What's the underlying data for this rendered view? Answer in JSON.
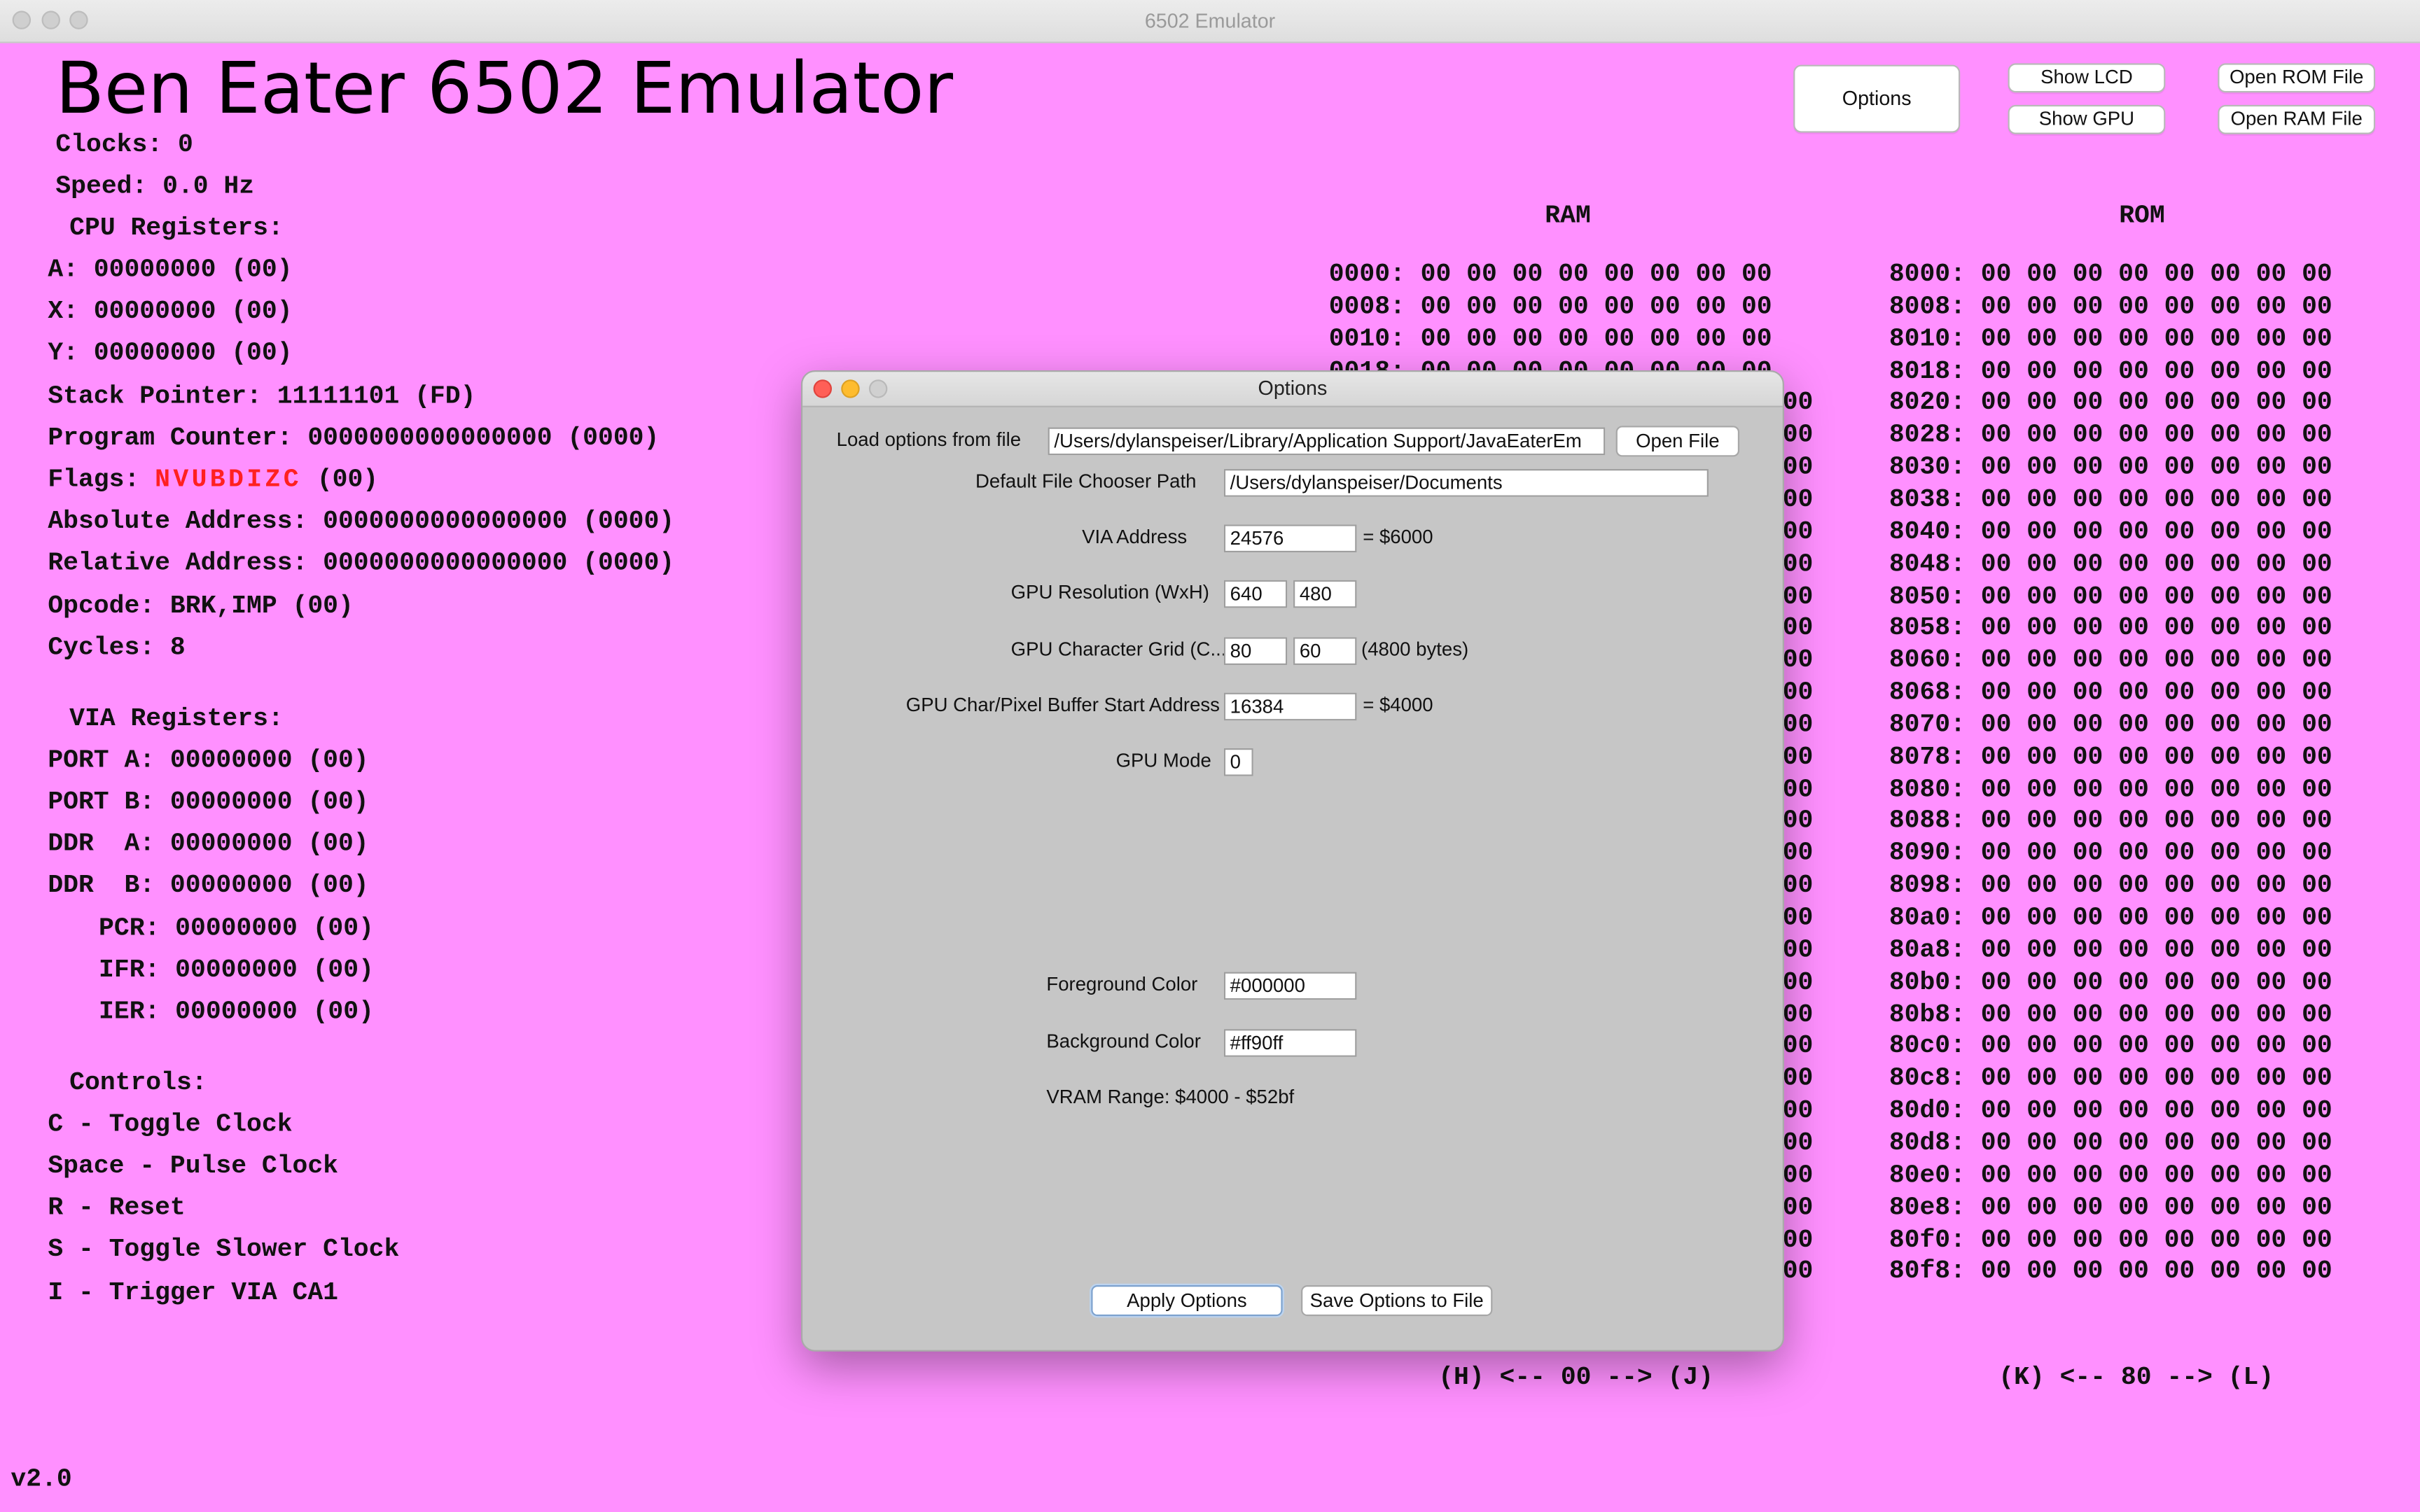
{
  "window": {
    "title": "6502 Emulator"
  },
  "app_title": "Ben Eater 6502 Emulator",
  "status": {
    "clocks": "Clocks: 0",
    "speed": "Speed: 0.0 Hz"
  },
  "cpu": {
    "header": "CPU Registers:",
    "a": "A: 00000000 (00)",
    "x": "X: 00000000 (00)",
    "y": "Y: 00000000 (00)",
    "sp": "Stack Pointer: 11111101 (FD)",
    "pc": "Program Counter: 0000000000000000 (0000)",
    "flags_label": "Flags: ",
    "flags_value": "NVUBDIZC",
    "flags_hex": " (00)",
    "abs": "Absolute Address: 0000000000000000 (0000)",
    "rel": "Relative Address: 0000000000000000 (0000)",
    "opcode": "Opcode: BRK,IMP (00)",
    "cycles": "Cycles: 8"
  },
  "via": {
    "header": "VIA Registers:",
    "porta": "PORT A: 00000000 (00)",
    "portb": "PORT B: 00000000 (00)",
    "ddra": "DDR  A: 00000000 (00)",
    "ddrb": "DDR  B: 00000000 (00)",
    "pcr": "PCR: 00000000 (00)",
    "ifr": "IFR: 00000000 (00)",
    "ier": "IER: 00000000 (00)"
  },
  "controls": {
    "header": "Controls:",
    "items": [
      "C - Toggle Clock",
      "Space - Pulse Clock",
      "R - Reset",
      "S - Toggle Slower Clock",
      "I - Trigger VIA CA1"
    ]
  },
  "version": "v2.0",
  "buttons": {
    "options": "Options",
    "show_lcd": "Show LCD",
    "show_gpu": "Show GPU",
    "open_rom": "Open ROM File",
    "open_ram": "Open RAM File"
  },
  "ram": {
    "title": "RAM",
    "rows": [
      "0000: 00 00 00 00 00 00 00 00",
      "0008: 00 00 00 00 00 00 00 00",
      "0010: 00 00 00 00 00 00 00 00",
      "0018: 00 00 00 00 00 00 00 00"
    ],
    "visible_tail": "00",
    "nav": "(H) <-- 00 --> (J)"
  },
  "rom": {
    "title": "ROM",
    "rows": [
      "8000: 00 00 00 00 00 00 00 00",
      "8008: 00 00 00 00 00 00 00 00",
      "8010: 00 00 00 00 00 00 00 00",
      "8018: 00 00 00 00 00 00 00 00",
      "8020: 00 00 00 00 00 00 00 00",
      "8028: 00 00 00 00 00 00 00 00",
      "8030: 00 00 00 00 00 00 00 00",
      "8038: 00 00 00 00 00 00 00 00",
      "8040: 00 00 00 00 00 00 00 00",
      "8048: 00 00 00 00 00 00 00 00",
      "8050: 00 00 00 00 00 00 00 00",
      "8058: 00 00 00 00 00 00 00 00",
      "8060: 00 00 00 00 00 00 00 00",
      "8068: 00 00 00 00 00 00 00 00",
      "8070: 00 00 00 00 00 00 00 00",
      "8078: 00 00 00 00 00 00 00 00",
      "8080: 00 00 00 00 00 00 00 00",
      "8088: 00 00 00 00 00 00 00 00",
      "8090: 00 00 00 00 00 00 00 00",
      "8098: 00 00 00 00 00 00 00 00",
      "80a0: 00 00 00 00 00 00 00 00",
      "80a8: 00 00 00 00 00 00 00 00",
      "80b0: 00 00 00 00 00 00 00 00",
      "80b8: 00 00 00 00 00 00 00 00",
      "80c0: 00 00 00 00 00 00 00 00",
      "80c8: 00 00 00 00 00 00 00 00",
      "80d0: 00 00 00 00 00 00 00 00",
      "80d8: 00 00 00 00 00 00 00 00",
      "80e0: 00 00 00 00 00 00 00 00",
      "80e8: 00 00 00 00 00 00 00 00",
      "80f0: 00 00 00 00 00 00 00 00",
      "80f8: 00 00 00 00 00 00 00 00"
    ],
    "nav": "(K) <-- 80 --> (L)"
  },
  "dialog": {
    "title": "Options",
    "load_label": "Load options from file",
    "load_value": "/Users/dylanspeiser/Library/Application Support/JavaEaterEm",
    "open_file": "Open File",
    "path_label": "Default File Chooser Path",
    "path_value": "/Users/dylanspeiser/Documents",
    "via_label": "VIA Address",
    "via_value": "24576",
    "via_hex": "= $6000",
    "gpu_res_label": "GPU Resolution (WxH)",
    "gpu_res_w": "640",
    "gpu_res_h": "480",
    "gpu_grid_label": "GPU Character Grid (C...",
    "gpu_grid_w": "80",
    "gpu_grid_h": "60",
    "gpu_grid_bytes": "(4800 bytes)",
    "gpu_buf_label": "GPU Char/Pixel Buffer Start Address",
    "gpu_buf_value": "16384",
    "gpu_buf_hex": "= $4000",
    "gpu_mode_label": "GPU Mode",
    "gpu_mode_value": "0",
    "fg_label": "Foreground Color",
    "fg_value": "#000000",
    "bg_label": "Background Color",
    "bg_value": "#ff90ff",
    "vram": "VRAM Range: $4000 - $52bf",
    "apply": "Apply Options",
    "save": "Save Options to File"
  },
  "colors": {
    "background": "#ff90ff",
    "flags": "#ff2020",
    "dialog_bg": "#c6c6c6"
  }
}
